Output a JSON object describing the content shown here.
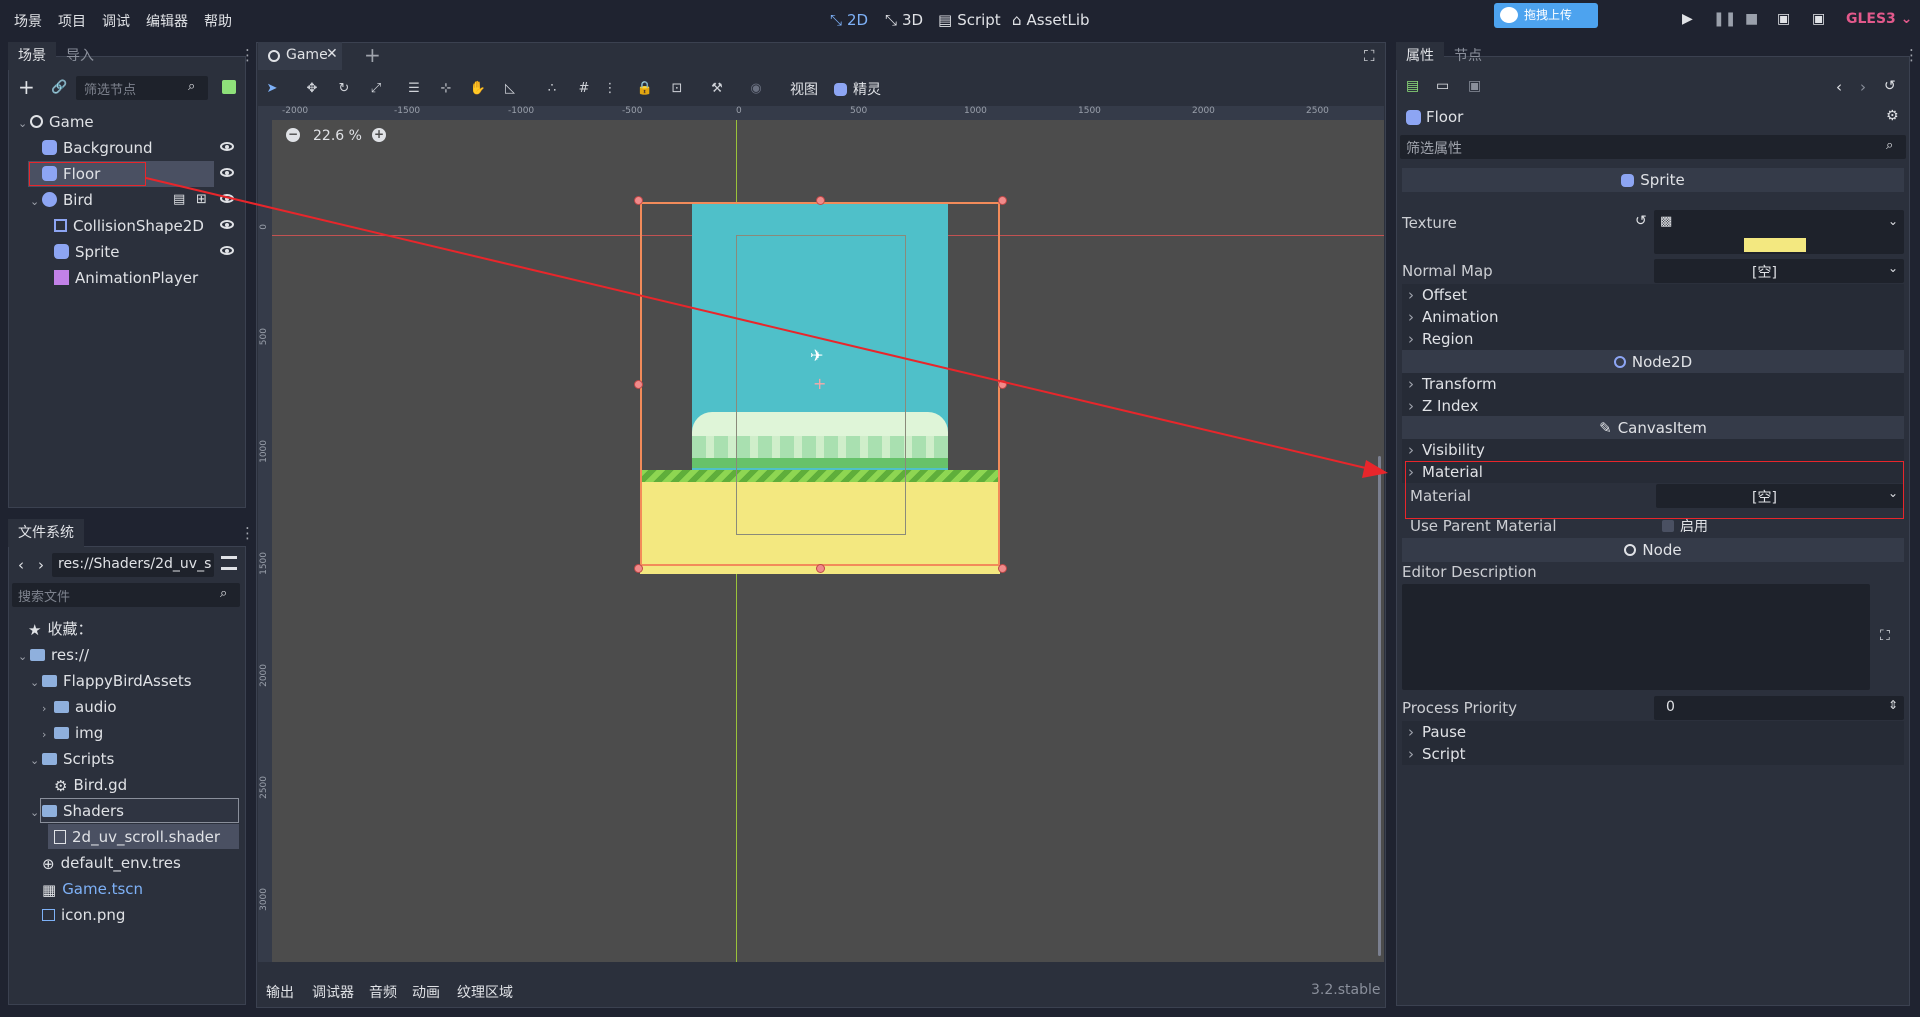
{
  "menu": [
    "场景",
    "项目",
    "调试",
    "编辑器",
    "帮助"
  ],
  "workspaces": {
    "w2d": "2D",
    "w3d": "3D",
    "script": "Script",
    "assetlib": "AssetLib"
  },
  "upload_badge": "拖拽上传",
  "renderer": "GLES3",
  "scene_dock": {
    "tabs": [
      "场景",
      "导入"
    ],
    "filter_placeholder": "筛选节点",
    "nodes": [
      {
        "name": "Game"
      },
      {
        "name": "Background"
      },
      {
        "name": "Floor"
      },
      {
        "name": "Bird"
      },
      {
        "name": "CollisionShape2D"
      },
      {
        "name": "Sprite"
      },
      {
        "name": "AnimationPlayer"
      }
    ]
  },
  "fs_dock": {
    "title": "文件系统",
    "path": "res://Shaders/2d_uv_s",
    "search_placeholder": "搜索文件",
    "items": [
      "收藏：",
      "res://",
      "FlappyBirdAssets",
      "audio",
      "img",
      "Scripts",
      "Bird.gd",
      "Shaders",
      "2d_uv_scroll.shader",
      "default_env.tres",
      "Game.tscn",
      "icon.png"
    ]
  },
  "editor": {
    "scene_tab": "Game",
    "view_menu": "视图",
    "sprite_menu": "精灵",
    "zoom": "22.6 %",
    "ruler_h": [
      "-2000",
      "-1500",
      "-1000",
      "-500",
      "0",
      "500",
      "1000",
      "1500",
      "2000",
      "2500"
    ],
    "ruler_v": [
      "0",
      "500",
      "1000",
      "1500",
      "2000",
      "2500",
      "3000"
    ]
  },
  "bottom_tabs": [
    "输出",
    "调试器",
    "音频",
    "动画",
    "纹理区域"
  ],
  "version": "3.2.stable",
  "inspector": {
    "tabs": [
      "属性",
      "节点"
    ],
    "object": "Floor",
    "filter_placeholder": "筛选属性",
    "sections": {
      "sprite": "Sprite",
      "node2d": "Node2D",
      "canvasitem": "CanvasItem",
      "node": "Node"
    },
    "texture_label": "Texture",
    "normal_map_label": "Normal Map",
    "normal_map_value": "[空]",
    "cats1": [
      "Offset",
      "Animation",
      "Region"
    ],
    "cats2": [
      "Transform",
      "Z Index"
    ],
    "visibility": "Visibility",
    "material_cat": "Material",
    "material_label": "Material",
    "material_value": "[空]",
    "use_parent_label": "Use Parent Material",
    "use_parent_value": "启用",
    "editor_description": "Editor Description",
    "process_priority_label": "Process Priority",
    "process_priority_value": "0",
    "cats3": [
      "Pause",
      "Script"
    ]
  },
  "colors": {
    "accent": "#7eb1f7",
    "sky": "#4fc0c9",
    "ground": "#f3e880",
    "grass": "#8ed652",
    "annotation": "#e8262b",
    "selection": "#f28b5a"
  }
}
